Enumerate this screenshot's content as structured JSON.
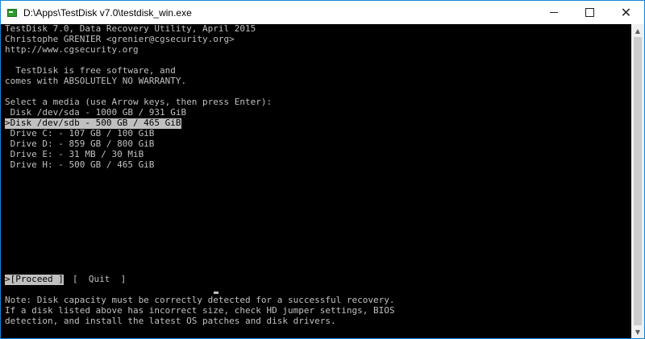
{
  "window": {
    "title": "D:\\Apps\\TestDisk v7.0\\testdisk_win.exe"
  },
  "controls": {
    "minimize": "minimize-icon",
    "maximize": "maximize-icon",
    "close": "close-icon"
  },
  "header": {
    "line1": "TestDisk 7.0, Data Recovery Utility, April 2015",
    "line2": "Christophe GRENIER <grenier@cgsecurity.org>",
    "line3": "http://www.cgsecurity.org"
  },
  "license": {
    "line1": "  TestDisk is free software, and",
    "line2": "comes with ABSOLUTELY NO WARRANTY."
  },
  "media": {
    "prompt": "Select a media (use Arrow keys, then press Enter):",
    "items": [
      " Disk /dev/sda - 1000 GB / 931 GiB",
      ">Disk /dev/sdb - 500 GB / 465 GiB",
      " Drive C: - 107 GB / 100 GiB",
      " Drive D: - 859 GB / 800 GiB",
      " Drive E: - 31 MB / 30 MiB",
      " Drive H: - 500 GB / 465 GiB"
    ]
  },
  "actions": {
    "proceed": ">[Proceed ]",
    "quit": "[  Quit  ]"
  },
  "note": {
    "line1": "Note: Disk capacity must be correctly detected for a successful recovery.",
    "line2": "If a disk listed above has incorrect size, check HD jumper settings, BIOS",
    "line3": "detection, and install the latest OS patches and disk drivers."
  },
  "colors": {
    "console_bg": "#000000",
    "console_fg": "#c0c0c0",
    "selection_bg": "#c0c0c0",
    "border_accent": "#1883d7"
  }
}
